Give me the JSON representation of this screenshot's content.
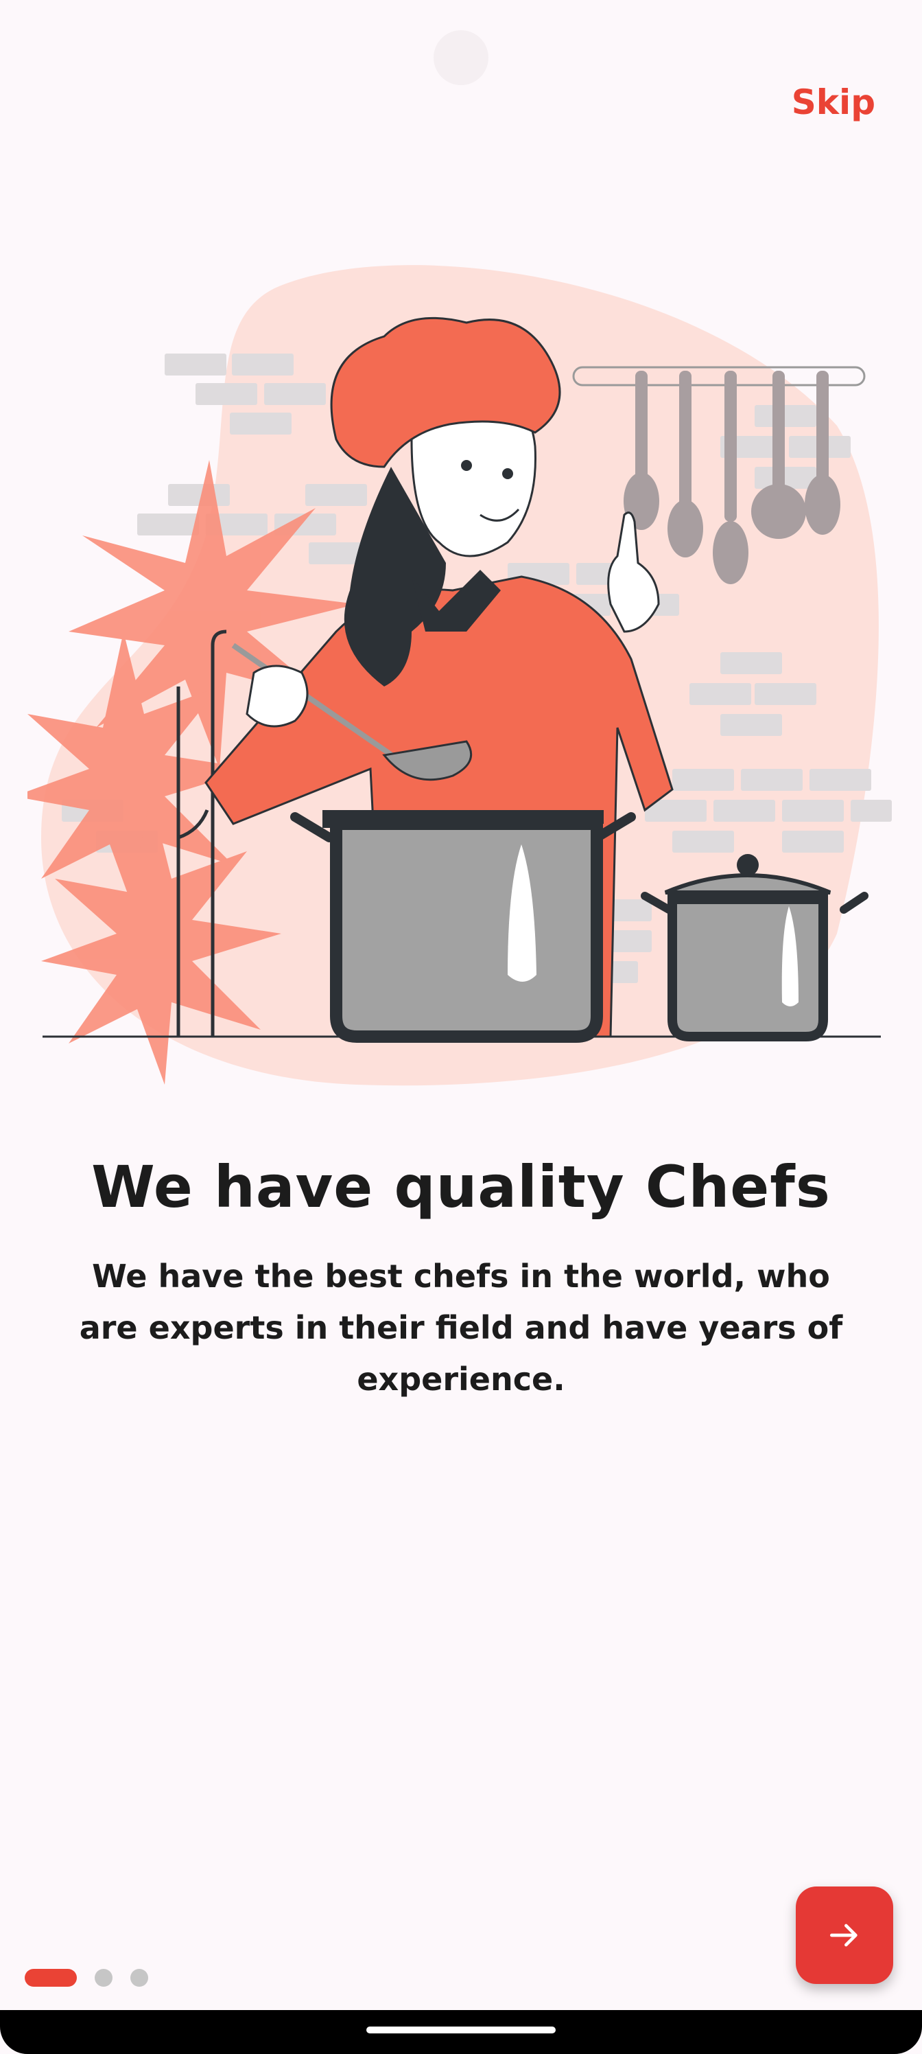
{
  "header": {
    "skip_label": "Skip"
  },
  "onboarding": {
    "title": "We have quality Chefs",
    "description": "We have the best chefs in the world, who are experts in their field and have years of experience.",
    "illustration": "chef-cooking-illustration"
  },
  "pagination": {
    "total": 3,
    "active": 1
  },
  "next_button": {
    "icon": "arrow-right-icon"
  },
  "colors": {
    "accent": "#ea4335",
    "background": "#fdf8fb",
    "text": "#1c1c1c",
    "dot_inactive": "#c6c6c6"
  }
}
